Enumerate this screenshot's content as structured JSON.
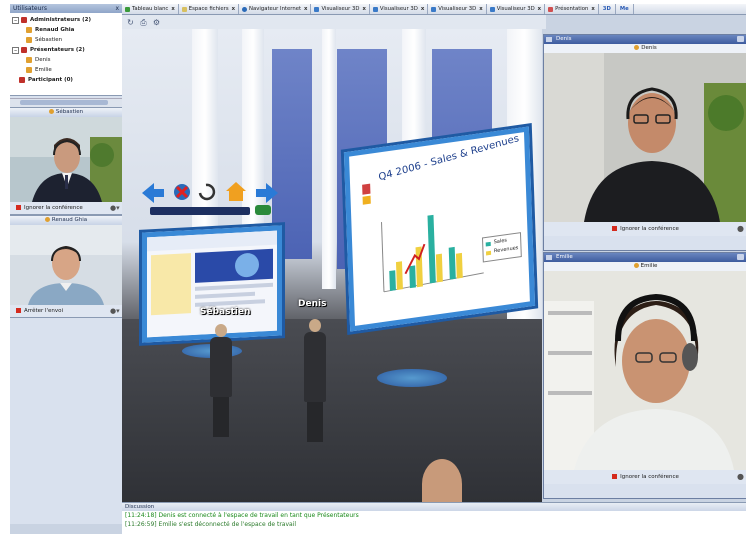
{
  "left_panel": {
    "title": "Utilisateurs",
    "close": "x",
    "tree": [
      {
        "label": "Administrateurs (2)",
        "group": true,
        "expander": "−"
      },
      {
        "label": "Renaud Ghia",
        "group": false,
        "bold": true
      },
      {
        "label": "Sébastien",
        "group": false
      },
      {
        "label": "Présentateurs (2)",
        "group": true,
        "expander": "−"
      },
      {
        "label": "Denis",
        "group": false
      },
      {
        "label": "Emilie",
        "group": false
      },
      {
        "label": "Participant (0)",
        "group": true,
        "expander": ""
      }
    ],
    "users": [
      {
        "name": "Sébastien",
        "action": "Ignorer la conférence"
      },
      {
        "name": "Renaud Ghia",
        "action": "Arrêter l'envoi"
      }
    ]
  },
  "tabs": [
    {
      "label": "Tableau blanc",
      "color": "#3a9a3a"
    },
    {
      "label": "Espace fichiers",
      "color": "#d8c060"
    },
    {
      "label": "Navigateur Internet",
      "color": "#2a6ab8"
    },
    {
      "label": "Visualiseur 3D",
      "color": "#3a7ac8"
    },
    {
      "label": "Visualiseur 3D",
      "color": "#3a7ac8"
    },
    {
      "label": "Visualiseur 3D",
      "color": "#3a7ac8"
    },
    {
      "label": "Visualiseur 3D",
      "color": "#3a7ac8"
    },
    {
      "label": "Présentation",
      "color": "#d05050"
    }
  ],
  "tab_icons": [
    "3D",
    "Me"
  ],
  "scene": {
    "board_title": "Q4 2006 - Sales & Revenues",
    "board_legend": [
      "Sales",
      "Revenues"
    ],
    "avatar_labels": [
      "Sébastien",
      "Denis"
    ]
  },
  "video_windows": [
    {
      "title": "Denis",
      "name": "Denis",
      "action": "Ignorer la conférence"
    },
    {
      "title": "Emilie",
      "name": "Emilie",
      "action": "Ignorer la conférence"
    }
  ],
  "discussion": {
    "title": "Discussion",
    "lines": [
      "[11:24:18] Denis est connecté à l'espace de travail en tant que Présentateurs",
      "[11:26:59] Emilie s'est déconnecté de l'espace de travail"
    ]
  },
  "colors": {
    "accent": "#3e5c9e",
    "board_frame": "#3a89d6",
    "stop": "#d42a1e"
  }
}
